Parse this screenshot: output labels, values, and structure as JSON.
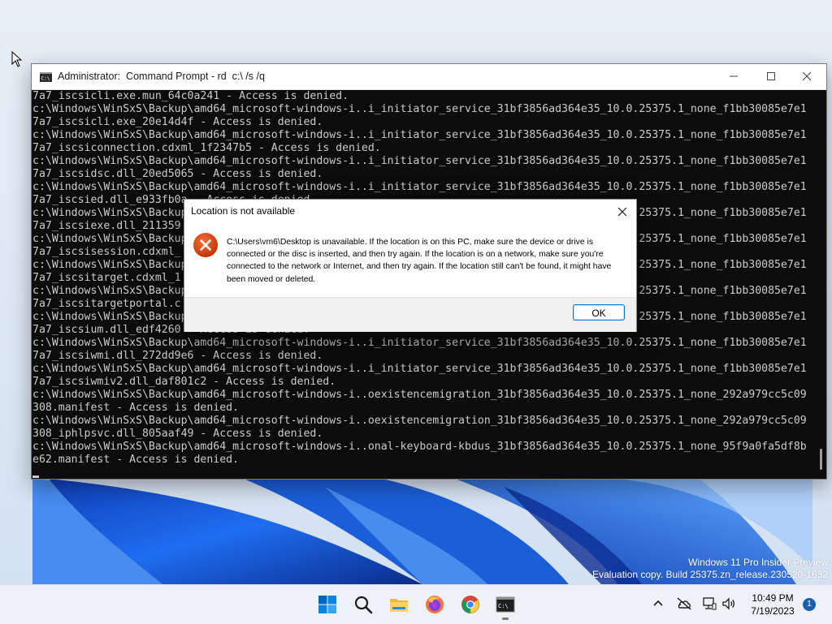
{
  "console": {
    "title": "Administrator:  Command Prompt - rd  c:\\ /s /q",
    "lines": [
      "7a7_iscsicli.exe.mun_64c0a241 - Access is denied.",
      "c:\\Windows\\WinSxS\\Backup\\amd64_microsoft-windows-i..i_initiator_service_31bf3856ad364e35_10.0.25375.1_none_f1bb30085e7e1",
      "7a7_iscsicli.exe_20e14d4f - Access is denied.",
      "c:\\Windows\\WinSxS\\Backup\\amd64_microsoft-windows-i..i_initiator_service_31bf3856ad364e35_10.0.25375.1_none_f1bb30085e7e1",
      "7a7_iscsiconnection.cdxml_1f2347b5 - Access is denied.",
      "c:\\Windows\\WinSxS\\Backup\\amd64_microsoft-windows-i..i_initiator_service_31bf3856ad364e35_10.0.25375.1_none_f1bb30085e7e1",
      "7a7_iscsidsc.dll_20ed5065 - Access is denied.",
      "c:\\Windows\\WinSxS\\Backup\\amd64_microsoft-windows-i..i_initiator_service_31bf3856ad364e35_10.0.25375.1_none_f1bb30085e7e1",
      "7a7_iscsied.dll_e933fb0a - Access is denied.",
      "c:\\Windows\\WinSxS\\Backup\\amd64_microsoft-windows-i..i_initiator_service_31bf3856ad364e35_10.0.25375.1_none_f1bb30085e7e1",
      "7a7_iscsiexe.dll_211359",
      "c:\\Windows\\WinSxS\\Backup\\amd64_microsoft-windows-i..i_initiator_service_31bf3856ad364e35_10.0.25375.1_none_f1bb30085e7e1",
      "7a7_iscsisession.cdxml_",
      "c:\\Windows\\WinSxS\\Backup\\amd64_microsoft-windows-i..i_initiator_service_31bf3856ad364e35_10.0.25375.1_none_f1bb30085e7e1",
      "7a7_iscsitarget.cdxml_1",
      "c:\\Windows\\WinSxS\\Backup\\amd64_microsoft-windows-i..i_initiator_service_31bf3856ad364e35_10.0.25375.1_none_f1bb30085e7e1",
      "7a7_iscsitargetportal.c",
      "c:\\Windows\\WinSxS\\Backup\\amd64_microsoft-windows-i..i_initiator_service_31bf3856ad364e35_10.0.25375.1_none_f1bb30085e7e1",
      "7a7_iscsium.dll_edf4260 - Access is denied.",
      "c:\\Windows\\WinSxS\\Backup\\amd64_microsoft-windows-i..i_initiator_service_31bf3856ad364e35_10.0.25375.1_none_f1bb30085e7e1",
      "7a7_iscsiwmi.dll_272dd9e6 - Access is denied.",
      "c:\\Windows\\WinSxS\\Backup\\amd64_microsoft-windows-i..i_initiator_service_31bf3856ad364e35_10.0.25375.1_none_f1bb30085e7e1",
      "7a7_iscsiwmiv2.dll_daf801c2 - Access is denied.",
      "c:\\Windows\\WinSxS\\Backup\\amd64_microsoft-windows-i..oexistencemigration_31bf3856ad364e35_10.0.25375.1_none_292a979cc5c09",
      "308.manifest - Access is denied.",
      "c:\\Windows\\WinSxS\\Backup\\amd64_microsoft-windows-i..oexistencemigration_31bf3856ad364e35_10.0.25375.1_none_292a979cc5c09",
      "308_iphlpsvc.dll_805aaf49 - Access is denied.",
      "c:\\Windows\\WinSxS\\Backup\\amd64_microsoft-windows-i..onal-keyboard-kbdus_31bf3856ad364e35_10.0.25375.1_none_95f9a0fa5df8b",
      "e62.manifest - Access is denied."
    ]
  },
  "dialog": {
    "title": "Location is not available",
    "message": "C:\\Users\\vm6\\Desktop is unavailable. If the location is on this PC, make sure the device or drive is connected or the disc is inserted, and then try again. If the location is on a network, make sure you're connected to the network or Internet, and then try again. If the location still can't be found, it might have been moved or deleted.",
    "ok_label": "OK"
  },
  "watermark": {
    "line1": "Windows 11 Pro Insider Preview",
    "line2": "Evaluation copy. Build 25375.zn_release.230520-1632"
  },
  "taskbar": {
    "pinned": [
      "windows-start-icon",
      "search-icon",
      "file-explorer-icon",
      "firefox-icon",
      "chrome-icon",
      "command-prompt-icon"
    ],
    "time": "10:49 PM",
    "date": "7/19/2023",
    "notification_count": "1"
  },
  "colors": {
    "console_bg": "#0c0c0c",
    "console_text": "#cccccc",
    "error_red": "#d83b01",
    "accent": "#0078d7"
  }
}
